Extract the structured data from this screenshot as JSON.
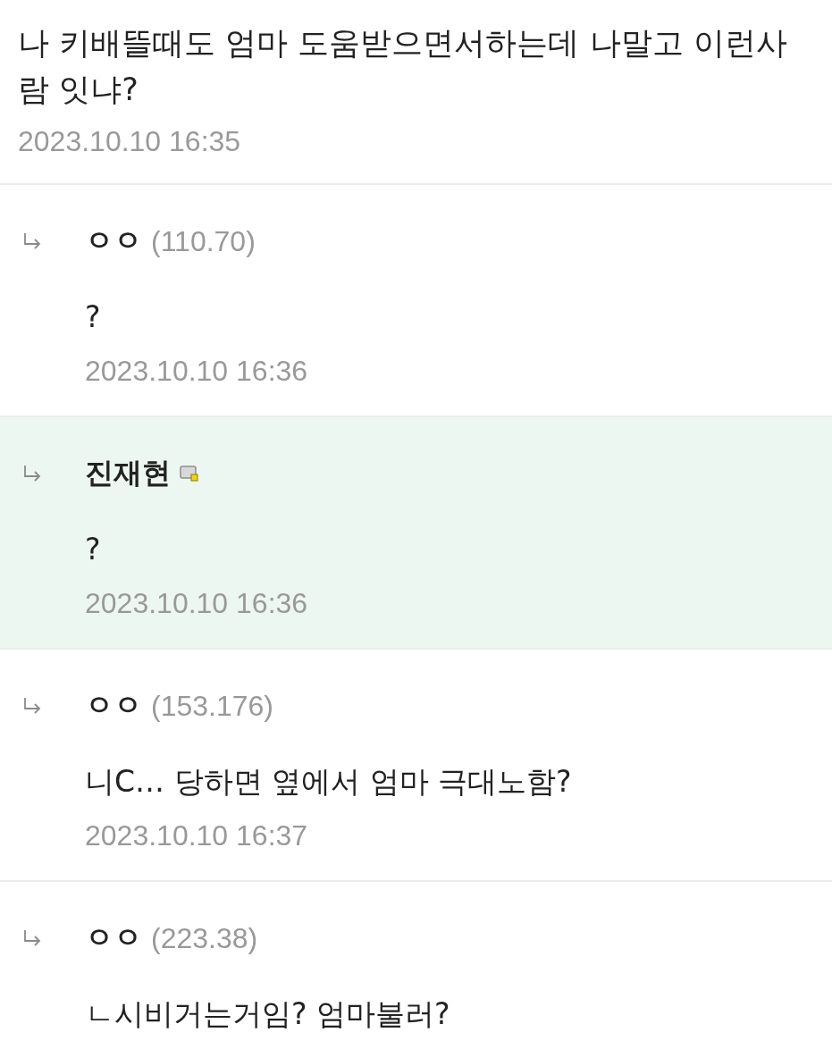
{
  "post": {
    "title": "나 키배뜰때도 엄마 도움받으면서하는데 나말고 이런사람 잇냐?",
    "date": "2023.10.10 16:35"
  },
  "replies": [
    {
      "author": "ㅇㅇ",
      "score": "(110.70)",
      "member": false,
      "highlighted": false,
      "text": "?",
      "date": "2023.10.10 16:36"
    },
    {
      "author": "진재현",
      "member": true,
      "highlighted": true,
      "text": "?",
      "date": "2023.10.10 16:36"
    },
    {
      "author": "ㅇㅇ",
      "score": "(153.176)",
      "member": false,
      "highlighted": false,
      "text": "니C… 당하면 옆에서 엄마 극대노함?",
      "date": "2023.10.10 16:37"
    },
    {
      "author": "ㅇㅇ",
      "score": "(223.38)",
      "member": false,
      "highlighted": false,
      "text": "ㄴ시비거는거임? 엄마불러?"
    }
  ]
}
